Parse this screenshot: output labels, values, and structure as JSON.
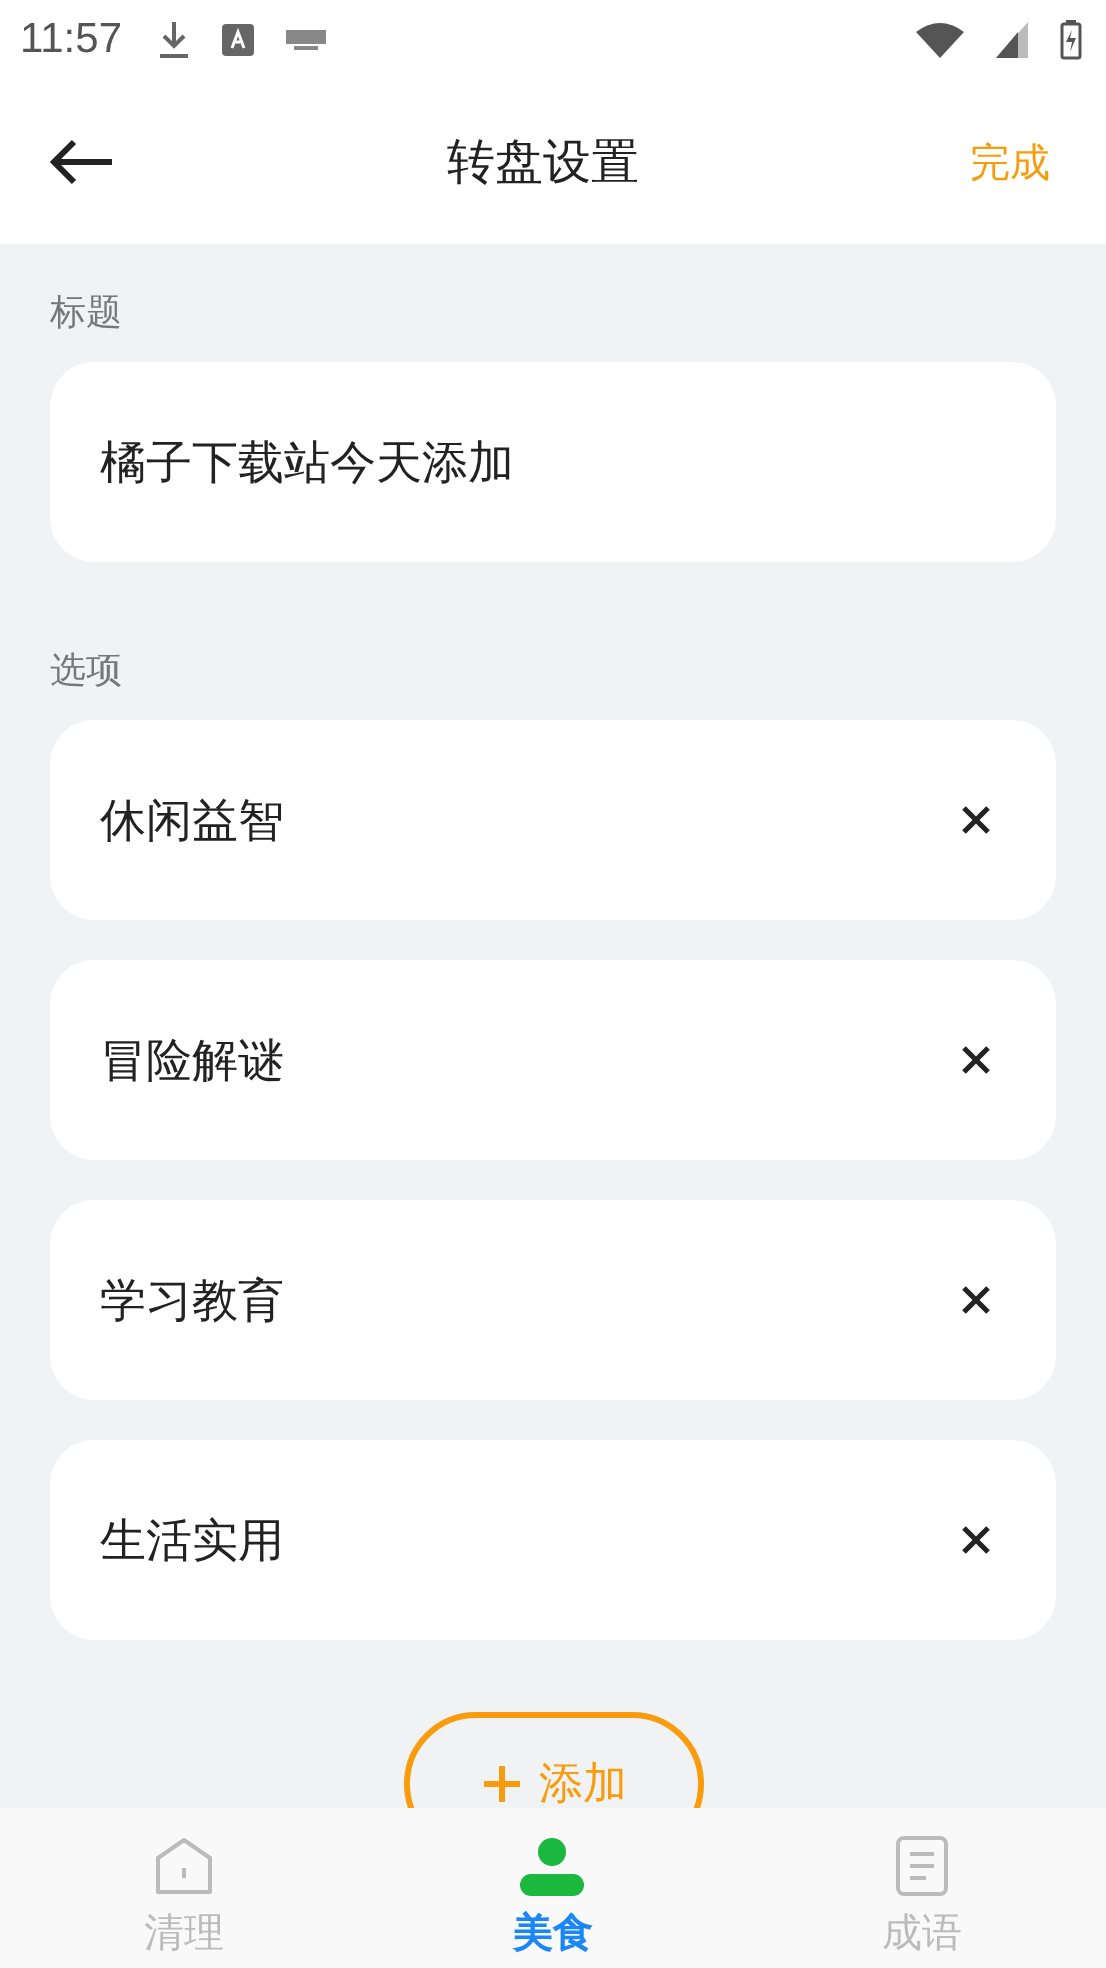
{
  "status_bar": {
    "time": "11:57"
  },
  "header": {
    "title": "转盘设置",
    "action": "完成"
  },
  "title_section": {
    "label": "标题",
    "value": "橘子下载站今天添加"
  },
  "options_section": {
    "label": "选项",
    "options": [
      {
        "text": "休闲益智"
      },
      {
        "text": "冒险解谜"
      },
      {
        "text": "学习教育"
      },
      {
        "text": "生活实用"
      }
    ]
  },
  "add_button": {
    "label": "添加"
  },
  "tab_bar": [
    {
      "label": "清理",
      "kind": "home",
      "selected": false
    },
    {
      "label": "美食",
      "kind": "person",
      "selected": true
    },
    {
      "label": "成语",
      "kind": "doc",
      "selected": false
    }
  ]
}
